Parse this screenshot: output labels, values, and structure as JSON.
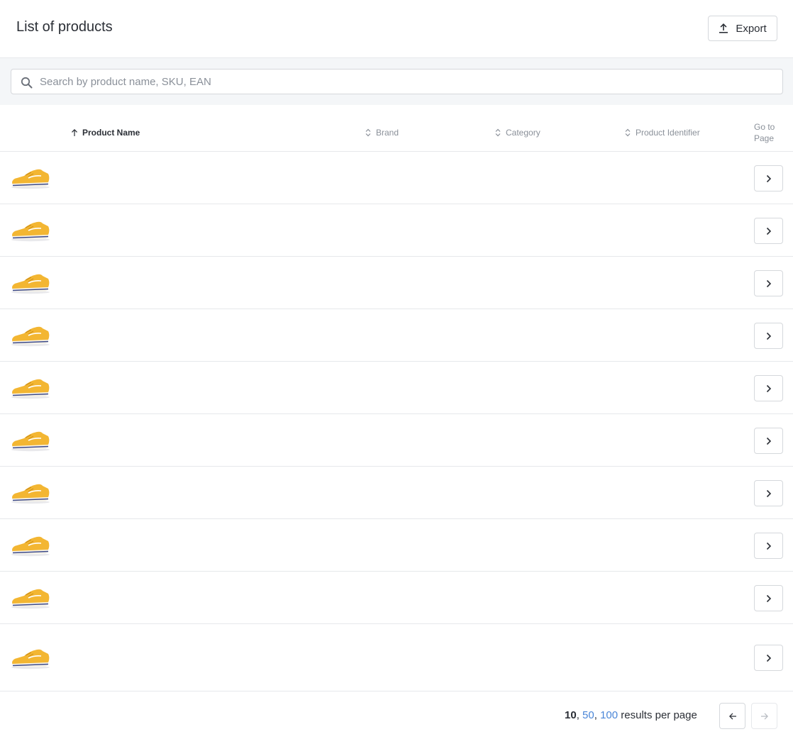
{
  "header": {
    "title": "List of products",
    "export_label": "Export",
    "export_icon": "upload-icon"
  },
  "search": {
    "placeholder": "Search by product name, SKU, EAN",
    "value": "",
    "icon": "search-icon"
  },
  "table": {
    "columns": [
      {
        "label": "Product Name",
        "sort": "ascending",
        "icon": "arrow-up-icon"
      },
      {
        "label": "Brand",
        "sort": "none",
        "icon": "sort-icon"
      },
      {
        "label": "Category",
        "sort": "none",
        "icon": "sort-icon"
      },
      {
        "label": "Product Identifier",
        "sort": "none",
        "icon": "sort-icon"
      }
    ],
    "go_to_page_label": "Go to Page",
    "rows": [
      {
        "image": "yellow-sneaker-image",
        "action_icon": "chevron-right-icon"
      },
      {
        "image": "yellow-sneaker-image",
        "action_icon": "chevron-right-icon"
      },
      {
        "image": "yellow-sneaker-image",
        "action_icon": "chevron-right-icon"
      },
      {
        "image": "yellow-sneaker-image",
        "action_icon": "chevron-right-icon"
      },
      {
        "image": "yellow-sneaker-image",
        "action_icon": "chevron-right-icon"
      },
      {
        "image": "yellow-sneaker-image",
        "action_icon": "chevron-right-icon"
      },
      {
        "image": "yellow-sneaker-image",
        "action_icon": "chevron-right-icon"
      },
      {
        "image": "yellow-sneaker-image",
        "action_icon": "chevron-right-icon"
      },
      {
        "image": "yellow-sneaker-image",
        "action_icon": "chevron-right-icon"
      },
      {
        "image": "yellow-sneaker-image",
        "action_icon": "chevron-right-icon"
      }
    ]
  },
  "pagination": {
    "current_per_page": "10",
    "sep1": ",",
    "option_50": "50",
    "sep2": ",",
    "option_100": "100",
    "suffix": "results per page",
    "prev_icon": "arrow-left-icon",
    "next_icon": "arrow-right-icon",
    "next_disabled": true
  },
  "colors": {
    "border": "#d5d8dc",
    "divider": "#e6e8eb",
    "search_band": "#f4f6f8",
    "link": "#4a86d8",
    "shoe_yellow": "#f3b632"
  }
}
